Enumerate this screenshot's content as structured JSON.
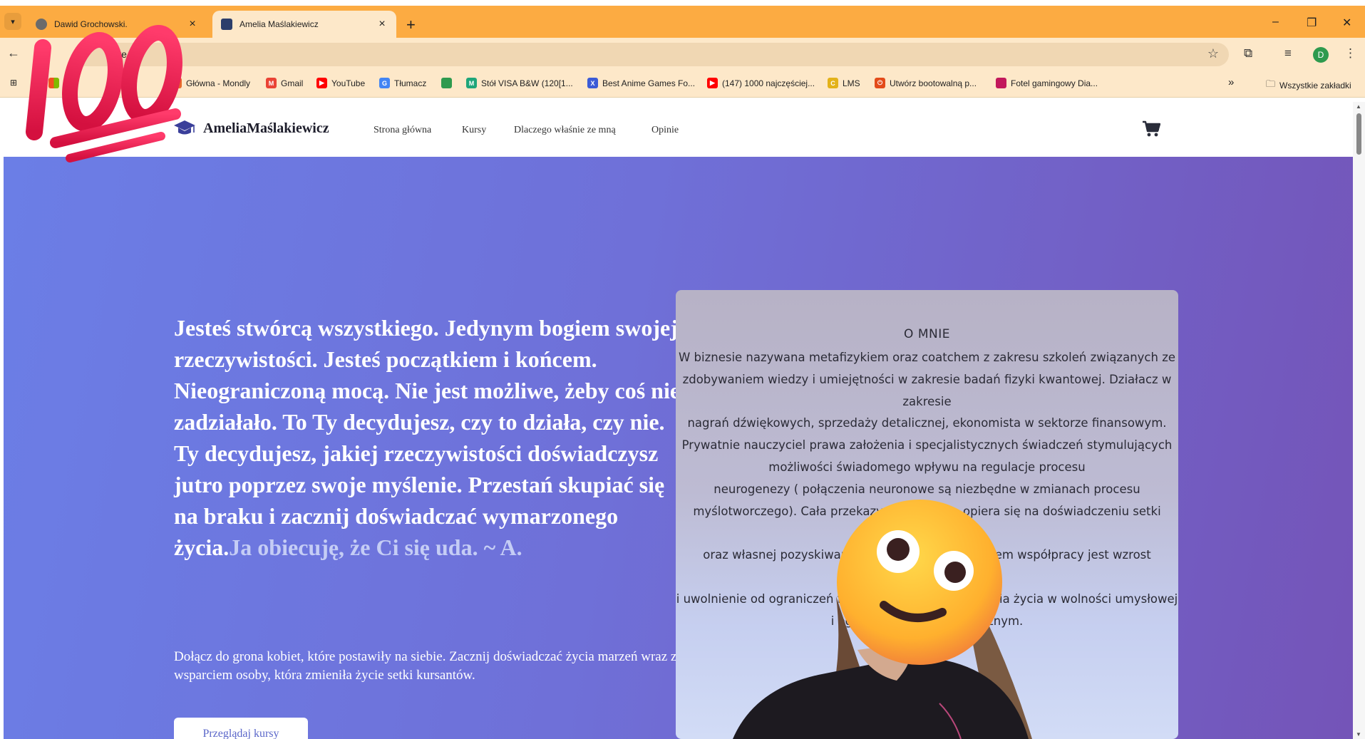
{
  "browser": {
    "tabs": [
      {
        "title": "Dawid Grochowski.",
        "active": false
      },
      {
        "title": "Amelia Maślakiewicz",
        "active": true
      }
    ],
    "new_tab": "+",
    "url_fragment": "we",
    "window_controls": [
      "–",
      "❐",
      "✕"
    ],
    "profile_initial": "D",
    "bookmarks": [
      {
        "label": "Główna - Mondly",
        "color": "#e86a2b"
      },
      {
        "label": "Gmail",
        "color": "#ea4335"
      },
      {
        "label": "YouTube",
        "color": "#ff0000"
      },
      {
        "label": "Tłumacz",
        "color": "#4285f4"
      },
      {
        "label": "",
        "color": "#2e9a4e"
      },
      {
        "label": "Stół VISA B&W (120[1...",
        "color": "#1fa67a"
      },
      {
        "label": "Best Anime Games Fo...",
        "color": "#3b5bd6"
      },
      {
        "label": "(147) 1000 najczęściej...",
        "color": "#ff0000"
      },
      {
        "label": "LMS",
        "color": "#e3b21a"
      },
      {
        "label": "Utwórz bootowalną p...",
        "color": "#e34b1a"
      },
      {
        "label": "Fotel gamingowy Dia...",
        "color": "#c2185b"
      }
    ],
    "more_bookmarks": "»",
    "all_bookmarks": "Wszystkie zakładki"
  },
  "site": {
    "brand": "AmeliaMaślakiewicz",
    "nav": [
      "Strona główna",
      "Kursy",
      "Dlaczego właśnie ze mną",
      "Opinie"
    ]
  },
  "hero": {
    "headline": "Jesteś stwórcą wszystkiego. Jedynym bogiem swojej rzeczywistości. Jesteś początkiem i końcem. Nieograniczoną mocą. Nie jest możliwe, żeby coś nie zadziałało. To Ty decydujesz, czy to działa, czy nie. Ty decydujesz, jakiej rzeczywistości doświadczysz jutro poprzez swoje myślenie. Przestań skupiać się na braku i zacznij doświadczać wymarzonego życia.",
    "headline_accent": "Ja obiecuję, że Ci się uda. ~ A.",
    "subtitle": "Dołącz do grona kobiet, które postawiły na siebie. Zacznij doświadczać życia marzeń wraz ze wsparciem osoby, która zmieniła życie setki kursantów.",
    "cta": "Przeglądaj kursy"
  },
  "about": {
    "title": "O MNIE",
    "lines": [
      "W biznesie nazywana metafizykiem oraz coatchem  z zakresu szkoleń związanych ze",
      "zdobywaniem wiedzy i umiejętności w zakresie badań fizyki kwantowej. Działacz w zakresie",
      "nagrań dźwiękowych, sprzedaży detalicznej, ekonomista w sektorze finansowym.",
      "Prywatnie nauczyciel prawa założenia i specjalistycznych świadczeń stymulujących",
      "możliwości świadomego wpływu na regulacje procesu",
      "neurogenezy ( połączenia neuronowe są niezbędne w zmianach procesu",
      "myślotworczego). Cała przekazywana wiedza opiera się na doświadczeniu setki kursantów",
      "oraz własnej pozyskiwanej codziennie wiedzy. Celem współpracy jest wzrost świadomości",
      "i uwolnienie od ograniczeń fizycznych w celu pozyskania życia w wolności umysłowej",
      "i ogromnym dostatku fizycznym."
    ]
  },
  "icons": {
    "brand": "graduation-cap-icon",
    "cart": "shopping-cart-icon",
    "sticker": "hundred-points-icon",
    "face_cover": "woozy-smiley-icon"
  },
  "colors": {
    "tabbar": "#fcab42",
    "toolbar": "#fde8c9",
    "hero_start": "#6b7ee6",
    "hero_end": "#7454b8",
    "accent_text": "#c5cdf5",
    "sticker_red": "#e8174f"
  }
}
